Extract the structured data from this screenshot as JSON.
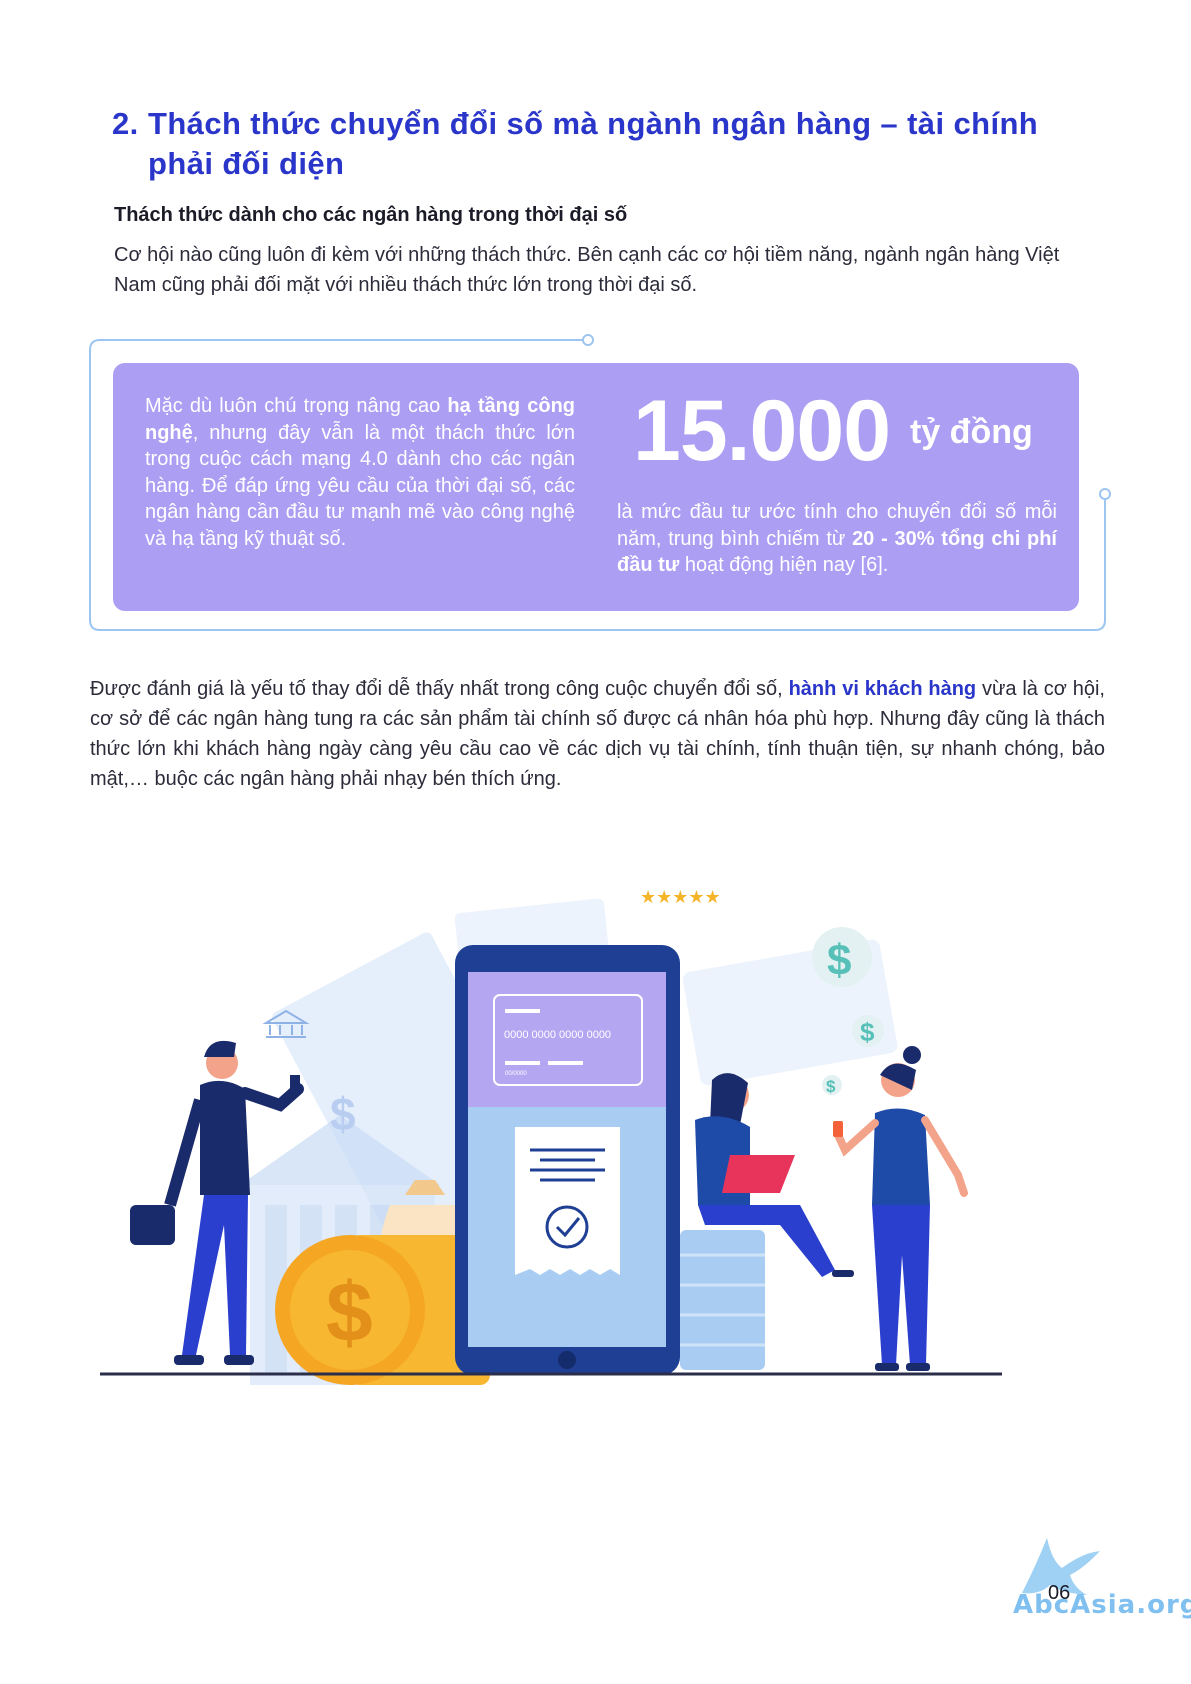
{
  "section": {
    "number": "2.",
    "title": "Thách thức chuyển đổi số mà ngành ngân hàng – tài chính phải đối diện"
  },
  "subheading": "Thách thức dành cho các ngân hàng trong thời đại số",
  "intro": "Cơ hội nào cũng luôn đi kèm với những thách thức. Bên cạnh các cơ hội tiềm năng, ngành ngân hàng Việt Nam cũng phải đối mặt với nhiều thách thức lớn trong thời đại số.",
  "callout": {
    "left": {
      "part1": "Mặc dù luôn chú trọng nâng cao ",
      "bold": "hạ tầng công nghệ",
      "part2": ", nhưng đây vẫn là một thách thức lớn trong cuộc cách mạng 4.0 dành cho các ngân hàng. Để đáp ứng yêu cầu của thời đại số, các ngân hàng cần đầu tư mạnh mẽ vào công nghệ và hạ tầng kỹ thuật số."
    },
    "stat_value": "15.000",
    "stat_unit": "tỷ đồng",
    "right": {
      "part1": "là mức đầu tư ước tính cho chuyển đổi số mỗi năm, trung bình chiếm từ ",
      "bold1": "20 - 30%",
      "part2": " ",
      "bold2": "tổng chi phí đầu tư",
      "part3": " hoạt động hiện nay [6]."
    }
  },
  "paragraph": {
    "part1": "Được đánh giá là yếu tố thay đổi dễ thấy nhất trong công cuộc chuyển đổi số, ",
    "highlight": "hành vi khách hàng",
    "part2": " vừa là cơ hội, cơ sở để các ngân hàng tung ra các sản phẩm tài chính số được cá nhân hóa phù hợp. Nhưng đây cũng là thách thức lớn khi khách hàng ngày càng yêu cầu cao về các dịch vụ tài chính, tính thuận tiện, sự nhanh chóng, bảo mật,… buộc các ngân hàng phải nhạy bén thích ứng."
  },
  "illustration": {
    "card_number": "0000 0000 0000 0000",
    "card_expiry": "00/0000",
    "stars": "★★★★★",
    "dollar": "$"
  },
  "footer": {
    "page_number": "06",
    "watermark": "AbcAsia.org"
  },
  "colors": {
    "heading": "#2a35c9",
    "callout_bg": "#ab9ef3",
    "frame_line": "#9cc6f0",
    "phone": "#1e3f93",
    "accent_yellow": "#f5b52a"
  }
}
